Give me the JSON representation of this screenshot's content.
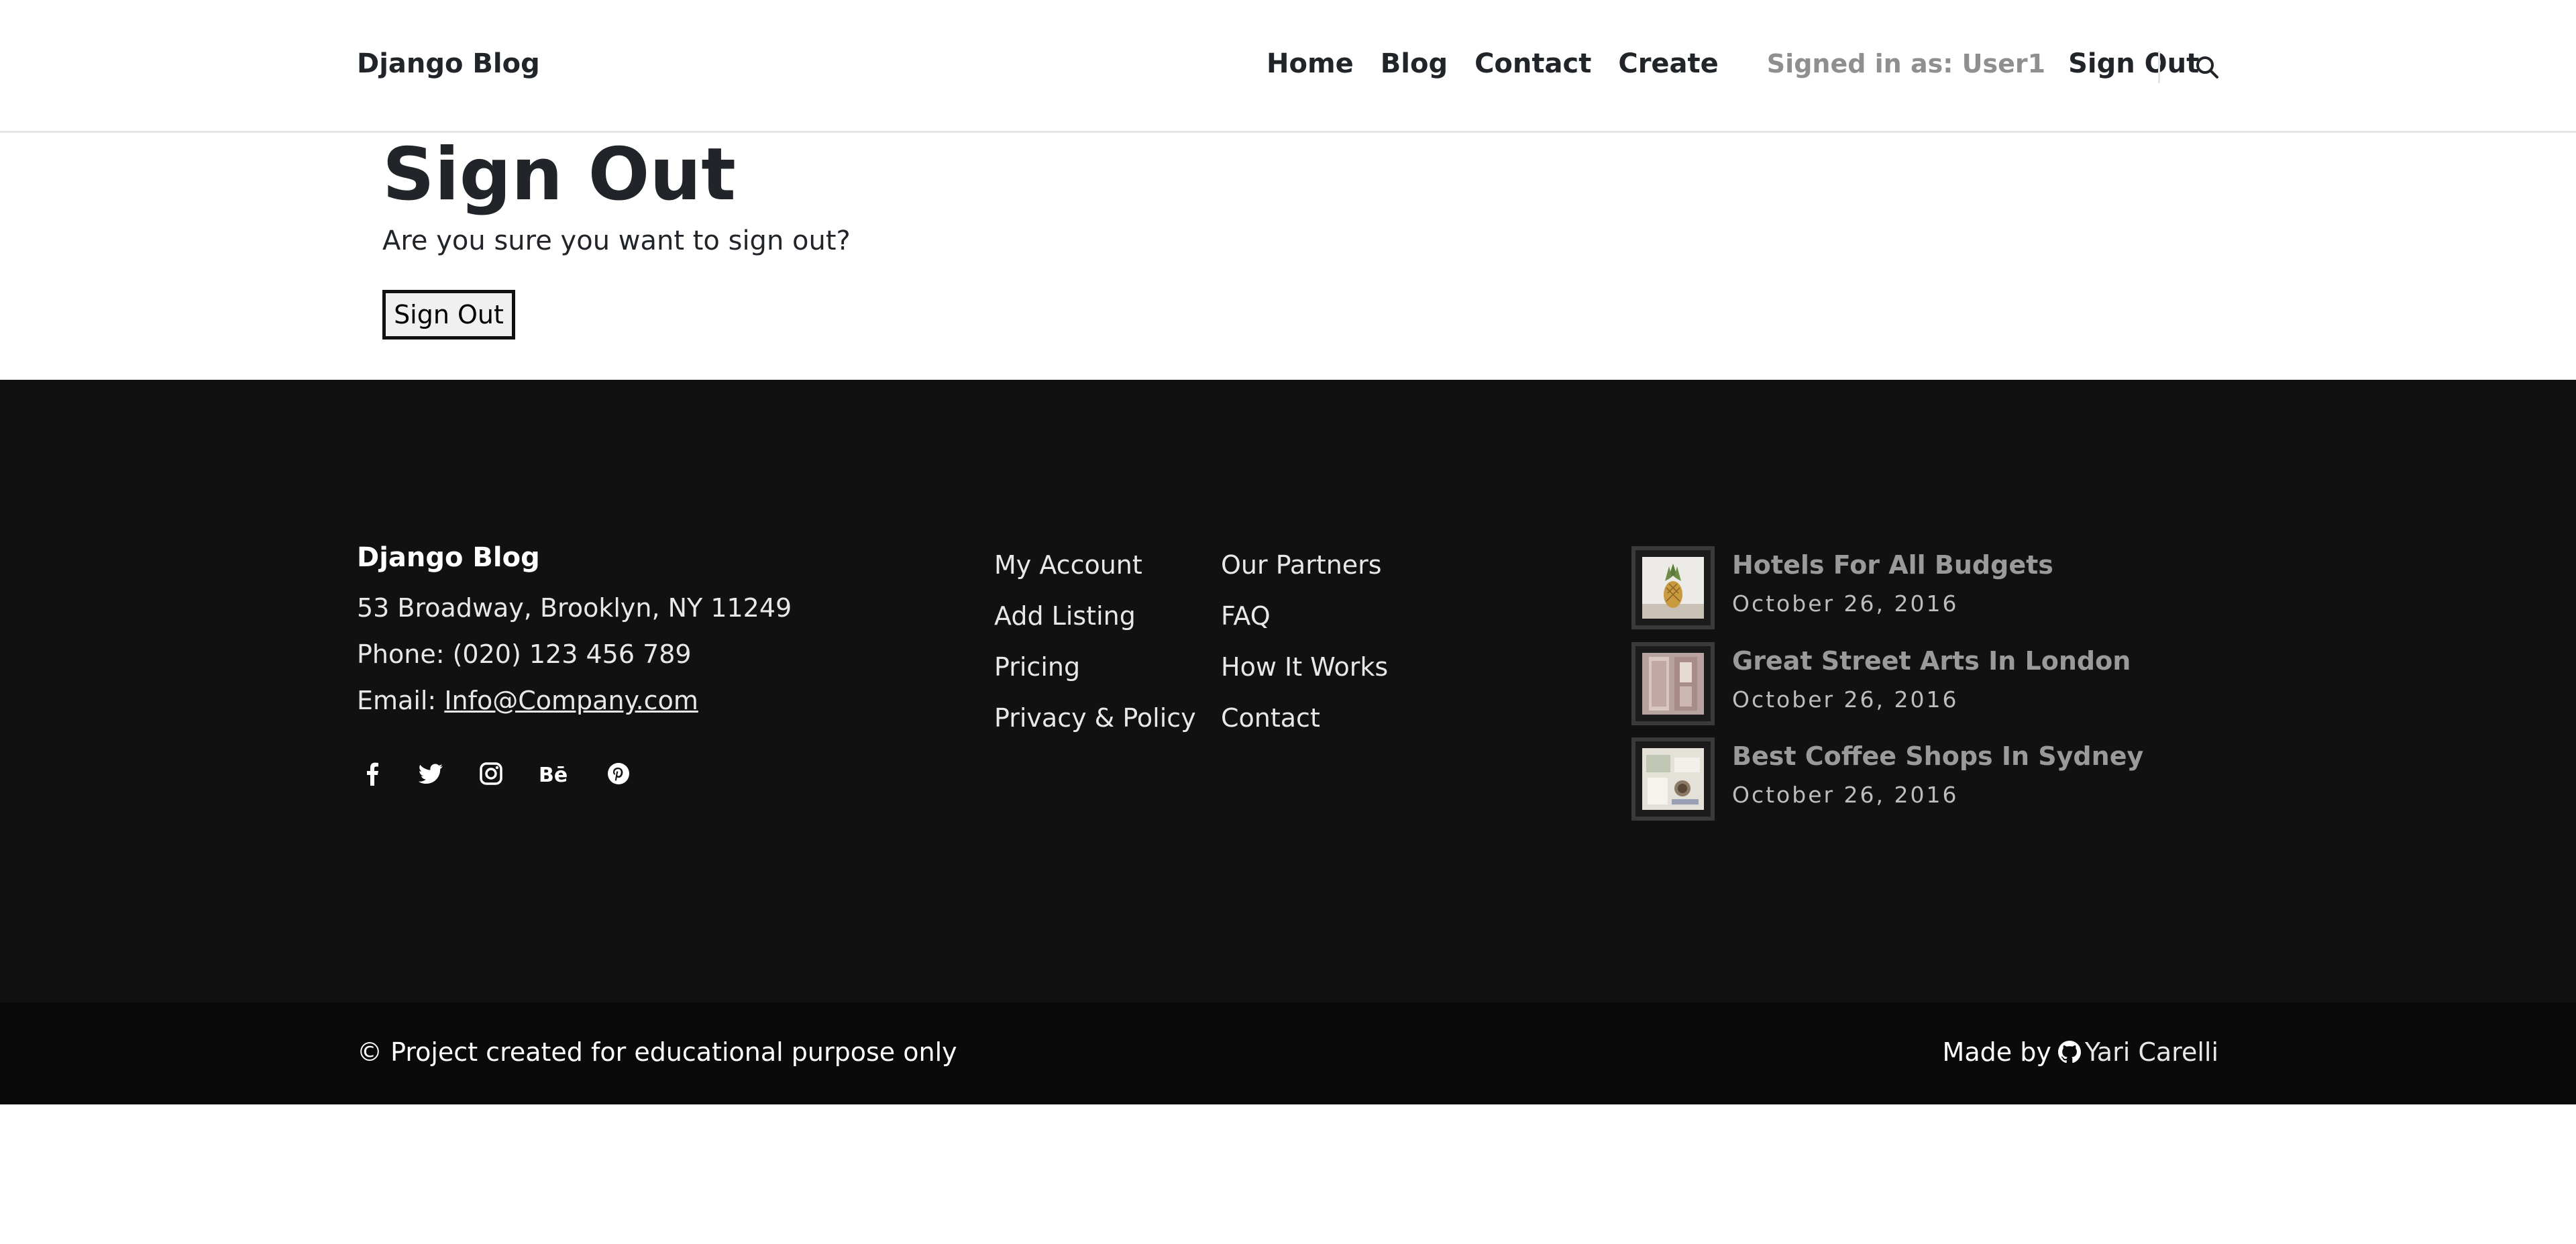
{
  "header": {
    "brand": "Django Blog",
    "nav": [
      "Home",
      "Blog",
      "Contact",
      "Create"
    ],
    "signed_in": "Signed in as: User1",
    "sign_out": "Sign Out",
    "search_icon": "search-icon"
  },
  "main": {
    "title": "Sign Out",
    "question": "Are you sure you want to sign out?",
    "button": "Sign Out"
  },
  "footer": {
    "brand": "Django Blog",
    "address": "53 Broadway, Brooklyn, NY 11249",
    "phone": "Phone: (020) 123 456 789",
    "email_label": "Email:",
    "email": "Info@Company.com",
    "social_icons": [
      "facebook-icon",
      "twitter-icon",
      "instagram-icon",
      "behance-icon",
      "pinterest-icon"
    ],
    "links_col1": [
      "My Account",
      "Add Listing",
      "Pricing",
      "Privacy & Policy"
    ],
    "links_col2": [
      "Our Partners",
      "FAQ",
      "How It Works",
      "Contact"
    ],
    "posts": [
      {
        "title": "Hotels For All Budgets",
        "date": "October 26, 2016"
      },
      {
        "title": "Great Street Arts In London",
        "date": "October 26, 2016"
      },
      {
        "title": "Best Coffee Shops In Sydney",
        "date": "October 26, 2016"
      }
    ],
    "copyright": "© Project created for educational purpose only",
    "made_by": "Made by",
    "author": "Yari Carelli",
    "colors": {
      "footer_bg": "#111111",
      "bottom_bg": "#0a0a0a"
    }
  }
}
